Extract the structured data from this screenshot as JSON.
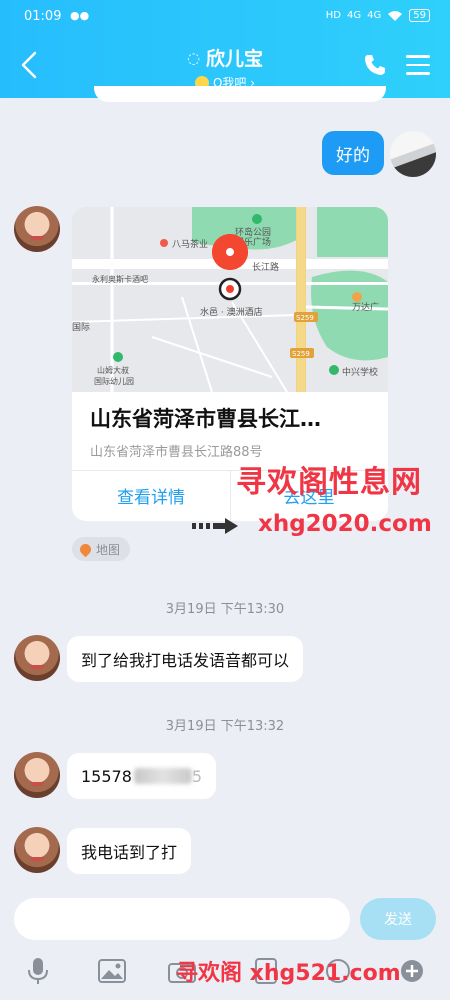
{
  "status_bar": {
    "time": "01:09",
    "network_1": "4G",
    "network_2": "4G",
    "battery": "59"
  },
  "header": {
    "title": "欣儿宝",
    "subtitle": "Q我吧 ›"
  },
  "messages": {
    "mine_text": "好的",
    "location_card": {
      "title": "山东省菏泽市曹县长江…",
      "address": "山东省菏泽市曹县长江路88号",
      "details_button": "查看详情",
      "navigate_button": "去这里",
      "map_labels": {
        "park": "环岛公园\n娱乐广场",
        "tea": "八马茶业",
        "hotel": "永利奥斯卡酒吧",
        "road": "长江路",
        "hotel2": "水邑 · 澳洲酒店",
        "school": "中兴学校",
        "kindergarten": "山姆大叔\n国际幼儿园",
        "plaza": "万达广",
        "intl": "国际",
        "s259a": "S259",
        "s259b": "S259"
      }
    },
    "map_tag": "地图",
    "time_1": "3月19日 下午13:30",
    "text_1": "到了给我打电话发语音都可以",
    "time_2": "3月19日 下午13:32",
    "text_2_visible": "15578",
    "text_2_tail": "5",
    "text_3": "我电话到了打"
  },
  "input": {
    "placeholder": "",
    "send_label": "发送"
  },
  "watermarks": {
    "line1": "寻欢阁性息网",
    "line2": "xhg2020.com",
    "line3": "寻欢阁 xhg521.com"
  },
  "colors": {
    "header": "#26bdfd",
    "mine_bubble": "#1e9bf4",
    "accent_link": "#20a0ef",
    "watermark": "#f03545"
  }
}
